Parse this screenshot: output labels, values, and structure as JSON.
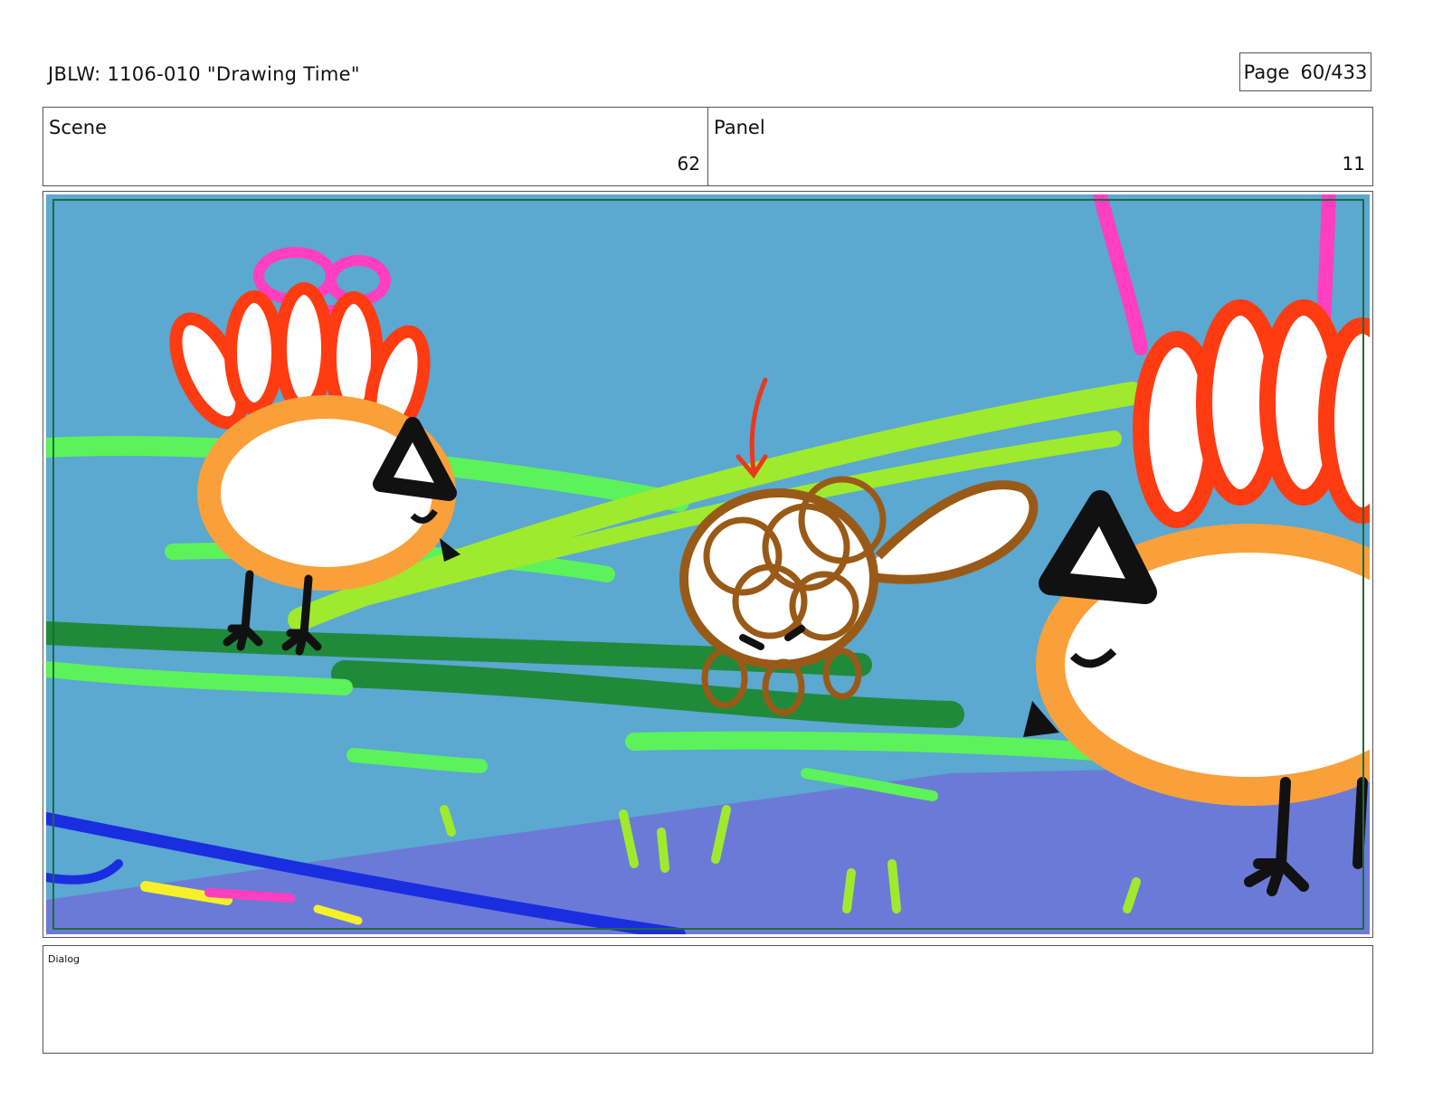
{
  "header": {
    "title": "JBLW: 1106-010 \"Drawing Time\"",
    "page_label": "Page",
    "page_number": "60/433"
  },
  "scene": {
    "label": "Scene",
    "value": "62"
  },
  "panel": {
    "label": "Panel",
    "value": "11"
  },
  "dialog": {
    "label": "Dialog"
  },
  "artwork": {
    "description_icon": "crayon-storyboard-illustration",
    "colors": {
      "sky": "#5ba8d0",
      "ground": "#6b7ad6",
      "grass_light": "#5cf25a",
      "grass_lime": "#9fea2d",
      "grass_dark": "#1f8a3a",
      "feather_red": "#ff3b12",
      "body_orange": "#f9a03a",
      "mouse_brown": "#9a5a17",
      "arrow_red": "#e8391e",
      "string_pink": "#ff3fc0",
      "stroke_blue": "#1a2ee0",
      "frame_green": "#1f6a3a"
    }
  }
}
